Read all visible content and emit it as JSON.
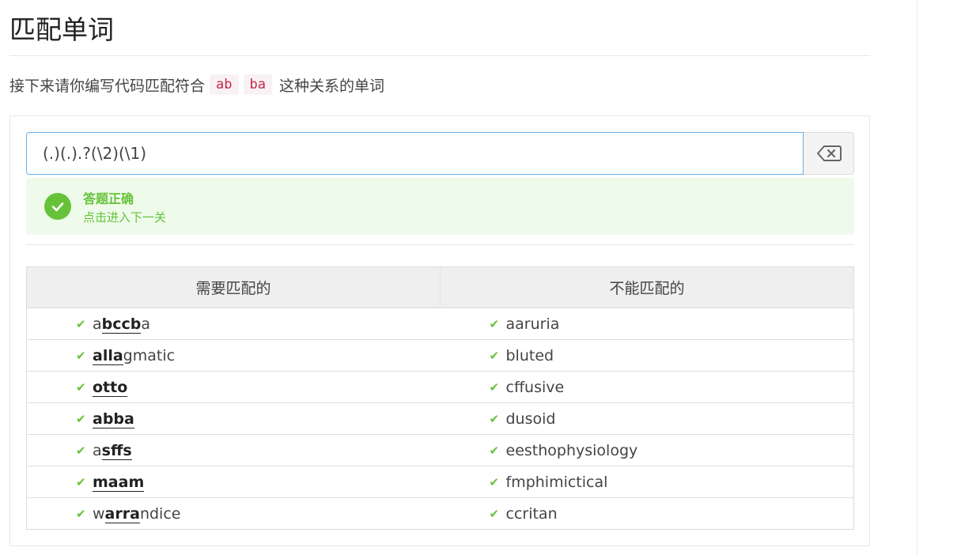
{
  "page": {
    "title": "匹配单词"
  },
  "instruction": {
    "text_before": "接下来请你编写代码匹配符合",
    "code_1": "ab",
    "code_2": "ba",
    "text_after": "这种关系的单词"
  },
  "input": {
    "value": "(.)(.).?(\\2)(\\1)"
  },
  "result": {
    "title": "答题正确",
    "link": "点击进入下一关",
    "color": "#67c23a"
  },
  "table": {
    "headers": [
      "需要匹配的",
      "不能匹配的"
    ],
    "match": [
      {
        "pre": "a",
        "hl": "bccb",
        "post": "a"
      },
      {
        "pre": "",
        "hl": "alla",
        "post": "gmatic"
      },
      {
        "pre": "",
        "hl": "otto",
        "post": ""
      },
      {
        "pre": "",
        "hl": "abba",
        "post": ""
      },
      {
        "pre": "a",
        "hl": "sffs",
        "post": ""
      },
      {
        "pre": "",
        "hl": "maam",
        "post": ""
      },
      {
        "pre": "w",
        "hl": "arra",
        "post": "ndice"
      }
    ],
    "nomatch": [
      "aaruria",
      "bluted",
      "cffusive",
      "dusoid",
      "eesthophysiology",
      "fmphimictical",
      "ccritan"
    ]
  },
  "icons": {
    "clear": "backspace-icon",
    "success": "check-circle-icon",
    "row_check": "check-icon"
  }
}
